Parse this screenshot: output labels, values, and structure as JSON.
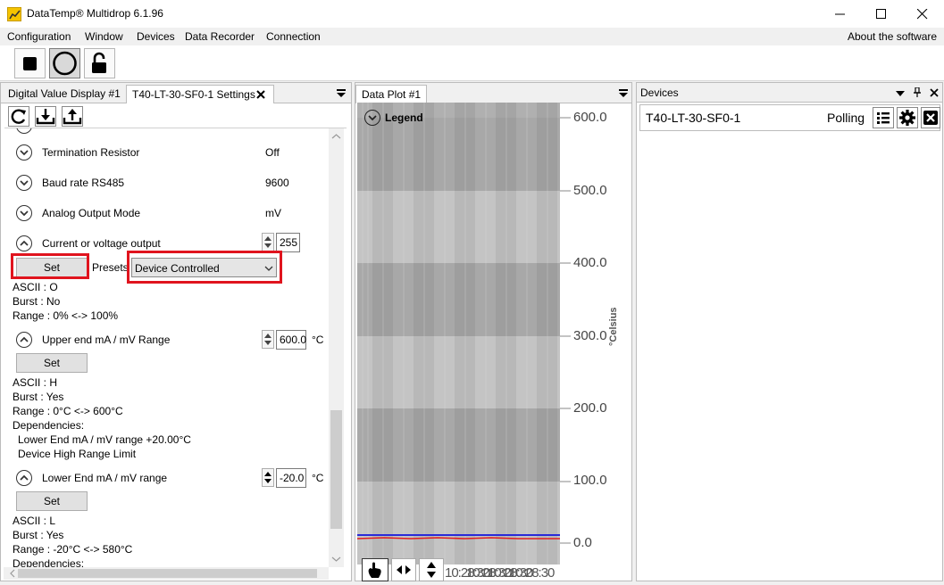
{
  "window": {
    "title": "DataTemp® Multidrop 6.1.96",
    "minimize_icon": "minimize-icon",
    "maximize_icon": "maximize-icon",
    "close_icon": "close-icon"
  },
  "menu": {
    "items": [
      "Configuration",
      "Window",
      "Devices",
      "Data Recorder",
      "Connection"
    ],
    "about": "About the software"
  },
  "toolbar": {
    "buttons": [
      "stop-square-icon",
      "record-circle-icon",
      "unlock-padlock-icon"
    ]
  },
  "left_panel": {
    "tabs": [
      {
        "label": "Digital Value Display #1"
      },
      {
        "label": "T40-LT-30-SF0-1 Settings"
      }
    ],
    "tool_icons": [
      "refresh-icon",
      "download-tray-icon",
      "upload-tray-icon"
    ],
    "settings": [
      {
        "label": "Termination Resistor",
        "value": "Off"
      },
      {
        "label": "Baud rate RS485",
        "value": "9600"
      },
      {
        "label": "Analog Output Mode",
        "value": "mV"
      }
    ],
    "current_output": {
      "label": "Current or voltage output",
      "value": "255",
      "set_label": "Set",
      "presets_label": "Presets",
      "preset_selected": "Device Controlled",
      "info": [
        "ASCII : O",
        "Burst : No",
        "Range : 0% <-> 100%"
      ]
    },
    "upper_end": {
      "label": "Upper end mA / mV Range",
      "value": "600.0",
      "unit": "°C",
      "set_label": "Set",
      "info": [
        "ASCII : H",
        "Burst : Yes",
        "Range : 0°C <-> 600°C",
        "Dependencies:"
      ],
      "dependencies": [
        "Lower End mA / mV range +20.00°C",
        "Device High Range Limit"
      ]
    },
    "lower_end": {
      "label": "Lower End mA / mV range",
      "value": "-20.0",
      "unit": "°C",
      "set_label": "Set",
      "info": [
        "ASCII : L",
        "Burst : Yes",
        "Range : -20°C <-> 580°C",
        "Dependencies:"
      ]
    }
  },
  "plot_panel": {
    "tab": "Data Plot #1",
    "legend": "Legend",
    "axis_title": "°Celsius",
    "y_ticks": [
      "600.0",
      "500.0",
      "400.0",
      "300.0",
      "200.0",
      "100.0",
      "0.0"
    ],
    "x_ticks_overlap": "10:28:30",
    "series_colors": {
      "blue": "#2a2ad8",
      "red": "#e01e1e"
    }
  },
  "devices_panel": {
    "title": "Devices",
    "device_name": "T40-LT-30-SF0-1",
    "status": "Polling"
  },
  "colors": {
    "highlight_red": "#e0141e",
    "panel_bg": "#ffffff",
    "chrome_bg": "#f0f0f0"
  }
}
